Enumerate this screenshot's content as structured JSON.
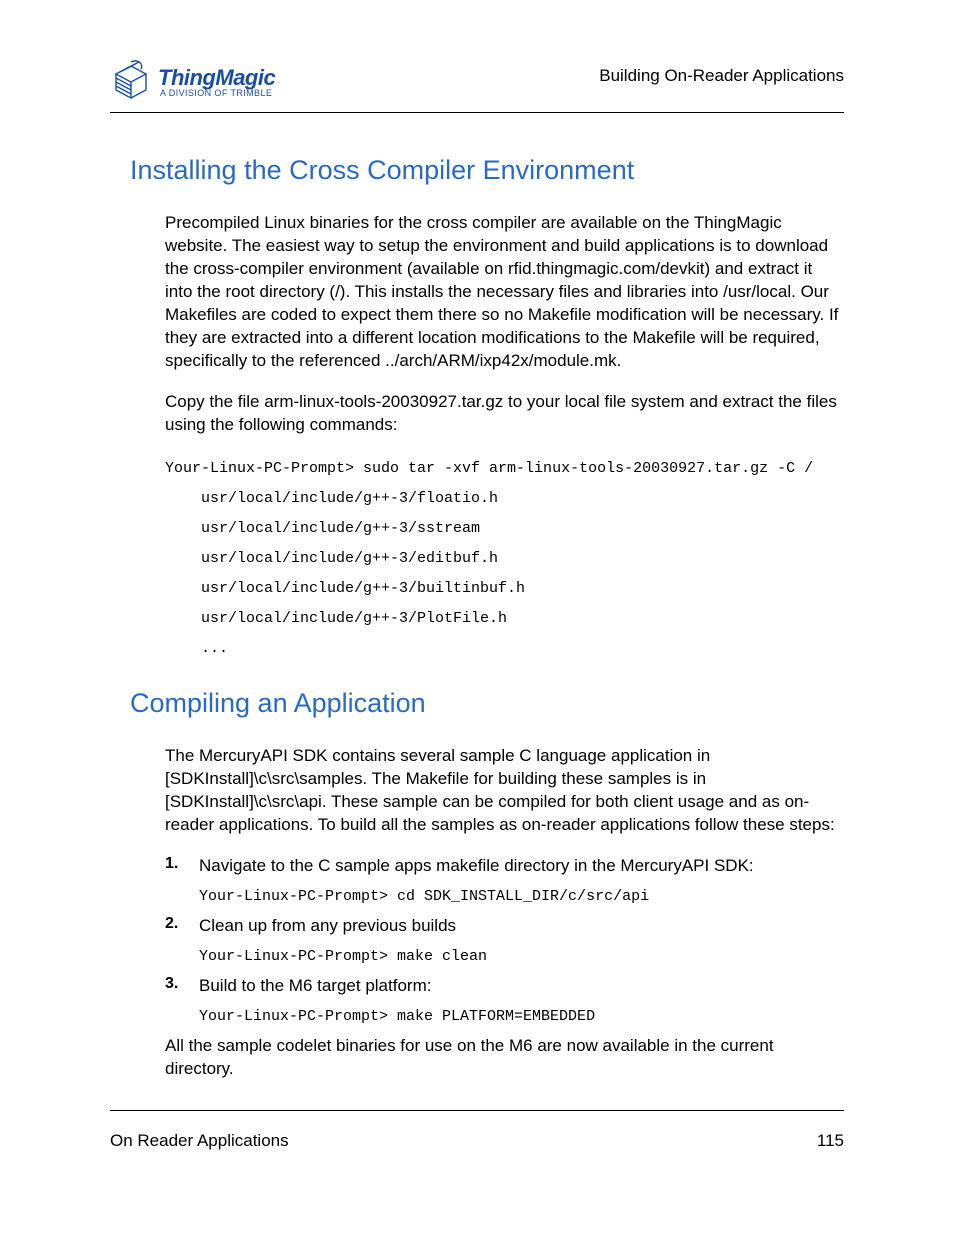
{
  "header": {
    "logo_main": "ThingMagic",
    "logo_sub": "A DIVISION OF TRIMBLE",
    "right_title": "Building On-Reader Applications"
  },
  "section1": {
    "heading": "Installing the Cross Compiler Environment",
    "para1": "Precompiled Linux binaries for the cross compiler are available on the ThingMagic website. The easiest way to setup the environment and build applications is to download the cross-compiler environment (available on rfid.thingmagic.com/devkit) and extract it into the root directory (/). This installs the necessary files and libraries into /usr/local. Our Makefiles are coded to expect them there so no Makefile modification will be necessary. If they are extracted into a different location modifications to the Makefile will be required, specifically to the referenced ../arch/ARM/ixp42x/module.mk.",
    "para2": "Copy the file arm-linux-tools-20030927.tar.gz to your local file system and extract the files using the following commands:",
    "code_line1": "Your-Linux-PC-Prompt> sudo tar -xvf arm-linux-tools-20030927.tar.gz -C /",
    "code_line2": "usr/local/include/g++-3/floatio.h",
    "code_line3": "usr/local/include/g++-3/sstream",
    "code_line4": "usr/local/include/g++-3/editbuf.h",
    "code_line5": "usr/local/include/g++-3/builtinbuf.h",
    "code_line6": "usr/local/include/g++-3/PlotFile.h",
    "code_line7": "..."
  },
  "section2": {
    "heading": "Compiling an Application",
    "para1": "The MercuryAPI SDK contains several sample C language application in [SDKInstall]\\c\\src\\samples. The Makefile for building these samples is in [SDKInstall]\\c\\src\\api. These sample can be compiled for both client usage and as on-reader applications. To build all the samples as on-reader applications follow these steps:",
    "steps": {
      "s1_text": "Navigate to the C sample apps makefile directory in the MercuryAPI SDK:",
      "s1_code": "Your-Linux-PC-Prompt> cd SDK_INSTALL_DIR/c/src/api",
      "s2_text": "Clean up from any previous builds",
      "s2_code": "Your-Linux-PC-Prompt> make clean",
      "s3_text": "Build to the M6 target platform:",
      "s3_code": "Your-Linux-PC-Prompt> make PLATFORM=EMBEDDED"
    },
    "para2": "All the sample codelet binaries for use on the M6 are now available in the current directory."
  },
  "footer": {
    "left": "On Reader Applications",
    "right": "115"
  }
}
